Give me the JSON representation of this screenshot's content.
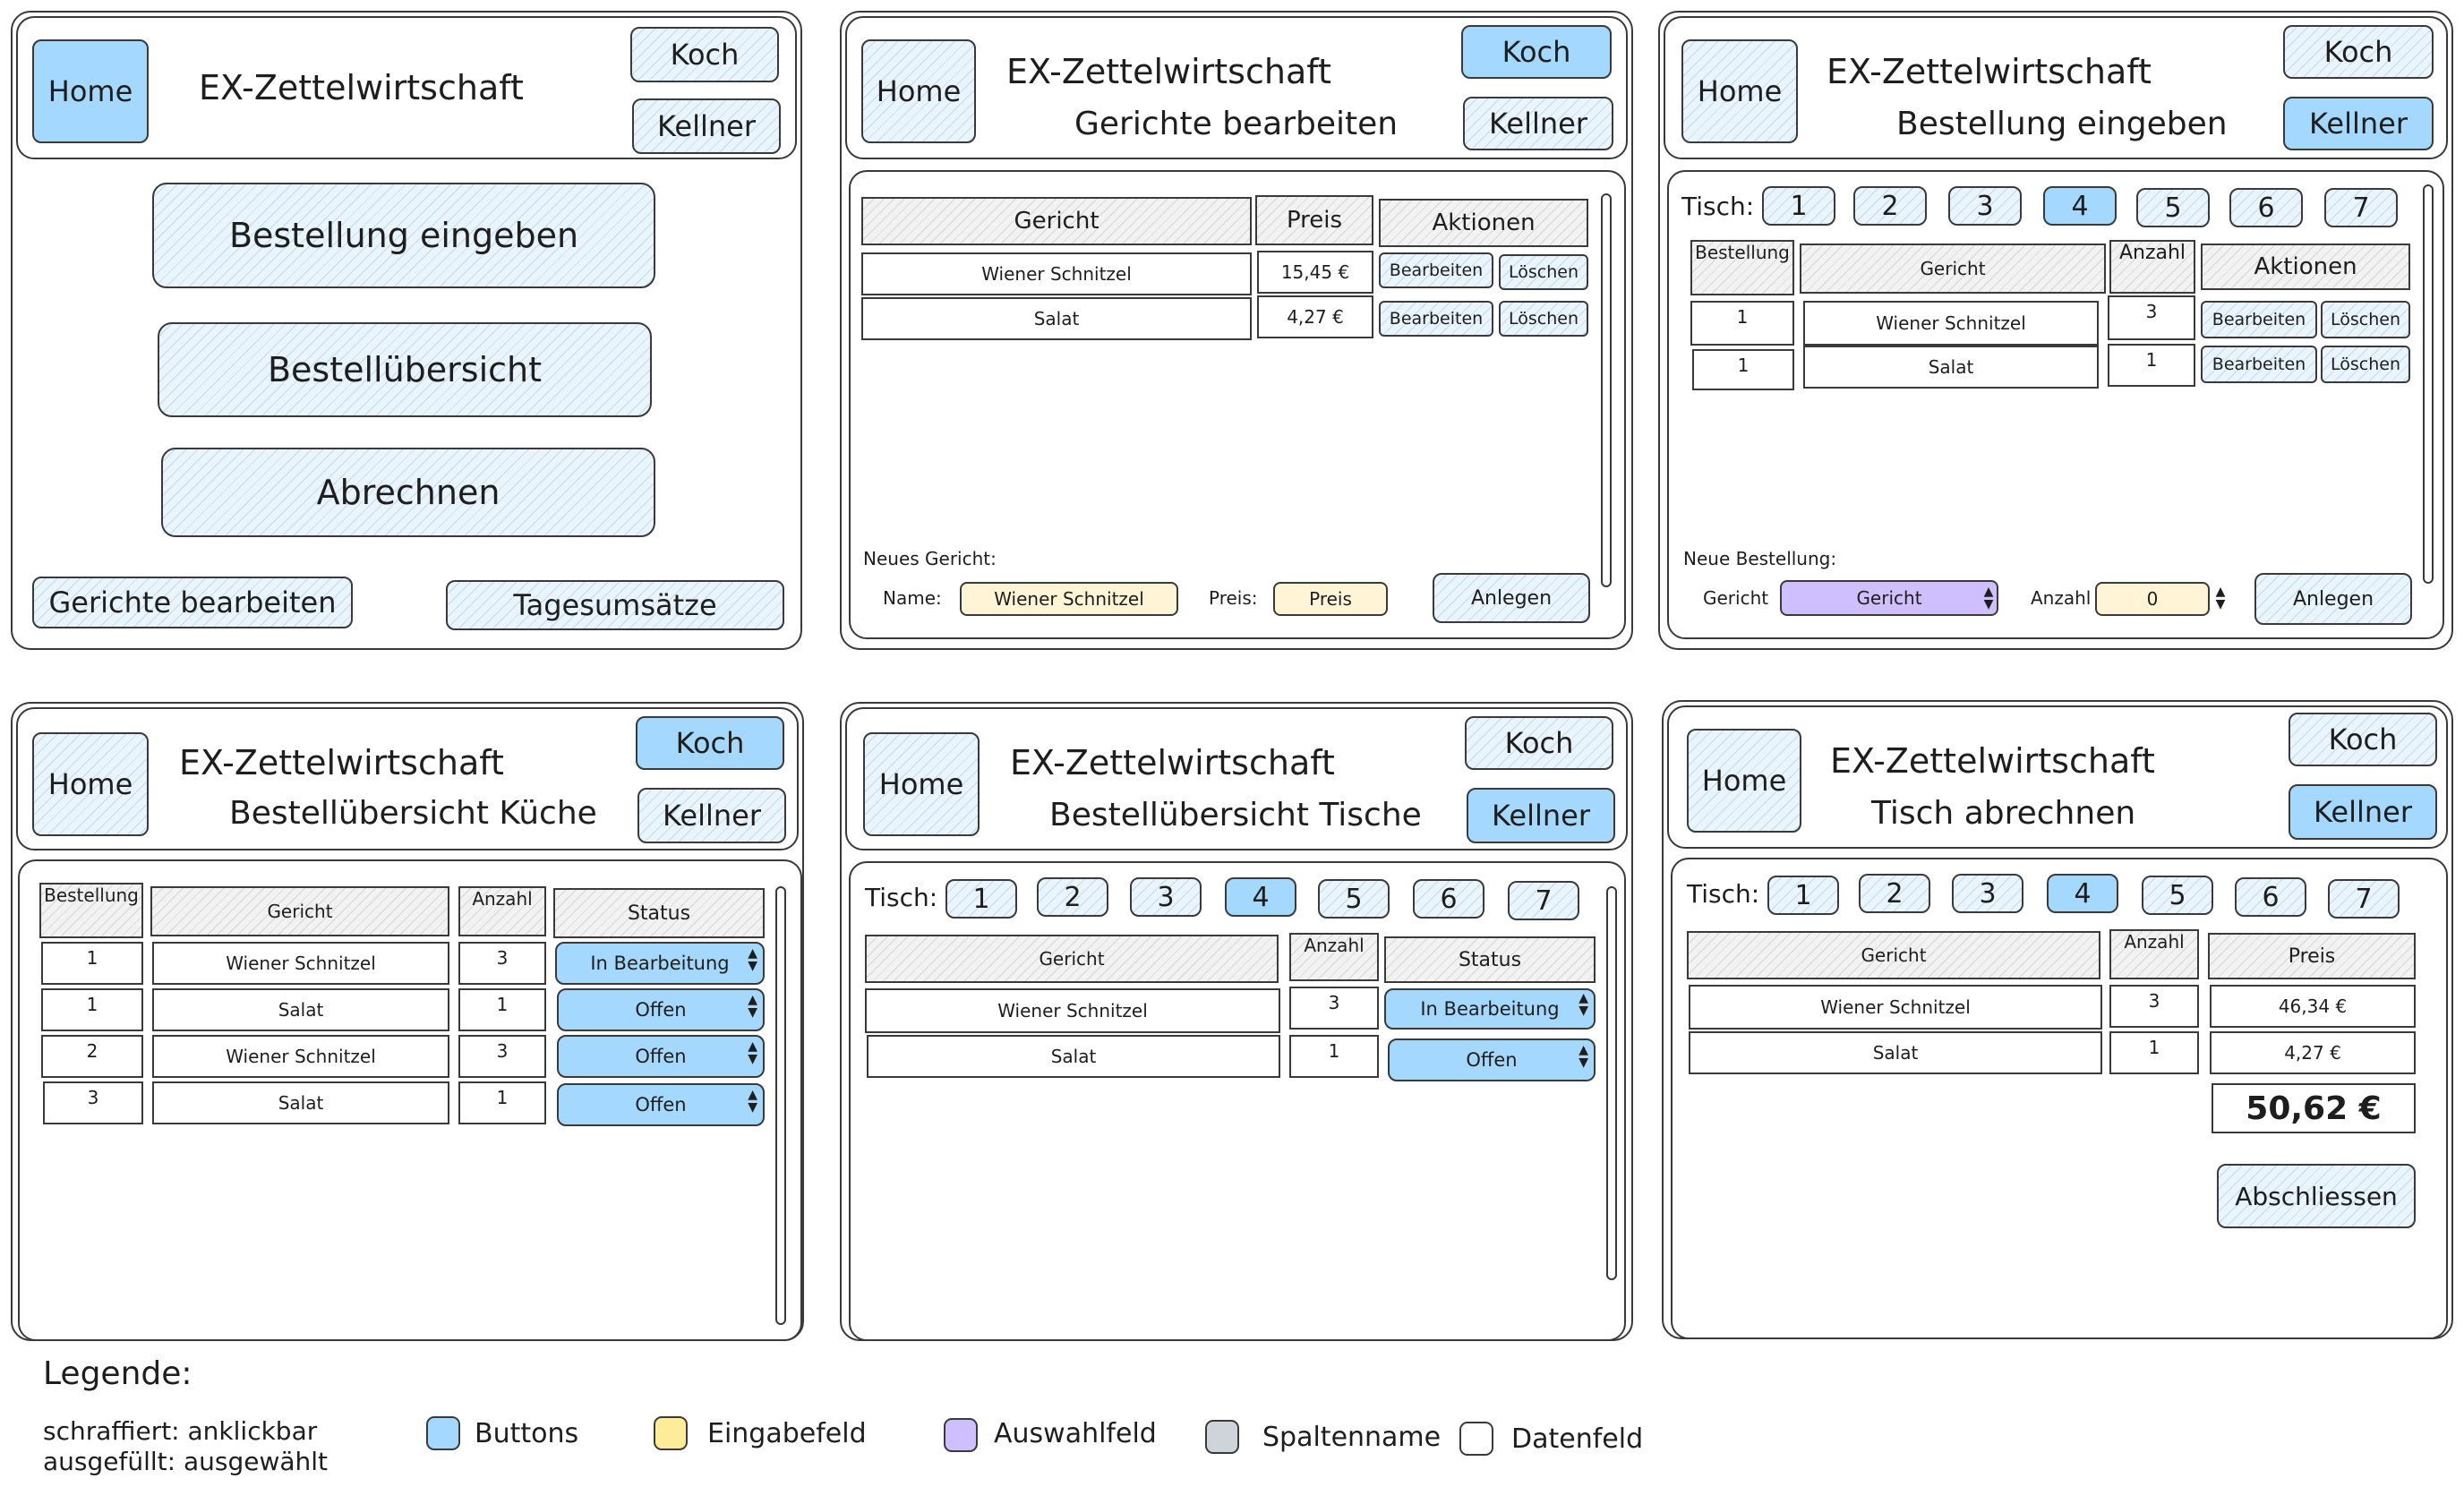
{
  "app_title": "EX-Zettelwirtschaft",
  "nav": {
    "home": "Home",
    "koch": "Koch",
    "kellner": "Kellner"
  },
  "screen_home": {
    "menu": [
      "Bestellung eingeben",
      "Bestellübersicht",
      "Abrechnen"
    ],
    "gerichte_bearbeiten": "Gerichte bearbeiten",
    "tagesumsaetze": "Tagesumsätze"
  },
  "screen_gerichte": {
    "subtitle": "Gerichte bearbeiten",
    "columns": [
      "Gericht",
      "Preis",
      "Aktionen"
    ],
    "rows": [
      {
        "gericht": "Wiener Schnitzel",
        "preis": "15,45 €"
      },
      {
        "gericht": "Salat",
        "preis": "4,27 €"
      }
    ],
    "edit_label": "Bearbeiten",
    "delete_label": "Löschen",
    "new_label": "Neues Gericht:",
    "name_label": "Name:",
    "name_value": "Wiener Schnitzel",
    "preis_label": "Preis:",
    "preis_placeholder": "Preis",
    "create_label": "Anlegen"
  },
  "screen_bestellung": {
    "subtitle": "Bestellung eingeben",
    "tisch_label": "Tisch:",
    "tables": [
      "1",
      "2",
      "3",
      "4",
      "5",
      "6",
      "7"
    ],
    "selected_table": "4",
    "columns": [
      "Bestellung",
      "Gericht",
      "Anzahl",
      "Aktionen"
    ],
    "rows": [
      {
        "bestellung": "1",
        "gericht": "Wiener Schnitzel",
        "anzahl": "3"
      },
      {
        "bestellung": "1",
        "gericht": "Salat",
        "anzahl": "1"
      }
    ],
    "edit_label": "Bearbeiten",
    "delete_label": "Löschen",
    "new_label": "Neue Bestellung:",
    "gericht_label": "Gericht",
    "gericht_select": "Gericht",
    "anzahl_label": "Anzahl",
    "anzahl_value": "0",
    "create_label": "Anlegen"
  },
  "screen_kueche": {
    "subtitle": "Bestellübersicht Küche",
    "columns": [
      "Bestellung",
      "Gericht",
      "Anzahl",
      "Status"
    ],
    "rows": [
      {
        "bestellung": "1",
        "gericht": "Wiener Schnitzel",
        "anzahl": "3",
        "status": "In Bearbeitung"
      },
      {
        "bestellung": "1",
        "gericht": "Salat",
        "anzahl": "1",
        "status": "Offen"
      },
      {
        "bestellung": "2",
        "gericht": "Wiener Schnitzel",
        "anzahl": "3",
        "status": "Offen"
      },
      {
        "bestellung": "3",
        "gericht": "Salat",
        "anzahl": "1",
        "status": "Offen"
      }
    ]
  },
  "screen_tische": {
    "subtitle": "Bestellübersicht Tische",
    "tisch_label": "Tisch:",
    "tables": [
      "1",
      "2",
      "3",
      "4",
      "5",
      "6",
      "7"
    ],
    "selected_table": "4",
    "columns": [
      "Gericht",
      "Anzahl",
      "Status"
    ],
    "rows": [
      {
        "gericht": "Wiener Schnitzel",
        "anzahl": "3",
        "status": "In Bearbeitung"
      },
      {
        "gericht": "Salat",
        "anzahl": "1",
        "status": "Offen"
      }
    ]
  },
  "screen_abrechnen": {
    "subtitle": "Tisch abrechnen",
    "tisch_label": "Tisch:",
    "tables": [
      "1",
      "2",
      "3",
      "4",
      "5",
      "6",
      "7"
    ],
    "selected_table": "4",
    "columns": [
      "Gericht",
      "Anzahl",
      "Preis"
    ],
    "rows": [
      {
        "gericht": "Wiener Schnitzel",
        "anzahl": "3",
        "preis": "46,34 €"
      },
      {
        "gericht": "Salat",
        "anzahl": "1",
        "preis": "4,27 €"
      }
    ],
    "total": "50,62 €",
    "close_label": "Abschliessen"
  },
  "legend": {
    "title": "Legende:",
    "line1": "schraffiert: anklickbar",
    "line2": "ausgefüllt: ausgewählt",
    "items": [
      {
        "label": "Buttons",
        "color": "#a5d8ff"
      },
      {
        "label": "Eingabefeld",
        "color": "#ffec99"
      },
      {
        "label": "Auswahlfeld",
        "color": "#d0bfff"
      },
      {
        "label": "Spaltenname",
        "color": "#ced4da"
      },
      {
        "label": "Datenfeld",
        "color": "#ffffff"
      }
    ]
  },
  "colors": {
    "selected": "#a5d8ff",
    "hatched": "#eaf4fc",
    "input": "#fff5d6",
    "select": "#d0bfff"
  }
}
